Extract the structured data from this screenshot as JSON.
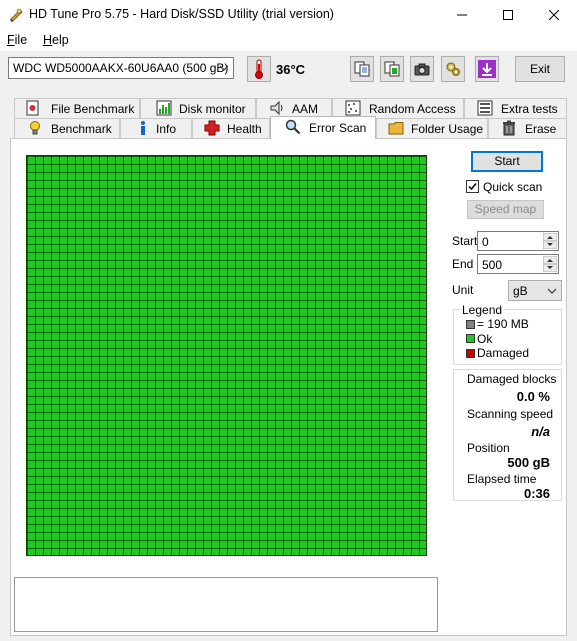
{
  "window": {
    "title": "HD Tune Pro 5.75 - Hard Disk/SSD Utility (trial version)",
    "controls": {
      "minimize": "–",
      "maximize": "☐",
      "close": "✕"
    }
  },
  "menu": {
    "file": "File",
    "file_hotkey": "F",
    "file_rest": "ile",
    "help": "Help",
    "help_hotkey": "H",
    "help_rest": "elp"
  },
  "toolbar": {
    "drive": "WDC WD5000AAKX-60U6AA0 (500 gB)",
    "temperature": "36°C",
    "exit_label": "Exit",
    "icons": [
      "copy-text-icon",
      "copy-screenshot-icon",
      "camera-icon",
      "options-icon",
      "save-icon"
    ]
  },
  "tabs": {
    "top_row": [
      "File Benchmark",
      "Disk monitor",
      "AAM",
      "Random Access",
      "Extra tests"
    ],
    "bottom_row": [
      "Benchmark",
      "Info",
      "Health",
      "Error Scan",
      "Folder Usage",
      "Erase"
    ],
    "active": "Error Scan"
  },
  "controls": {
    "start_label": "Start",
    "quick_scan_label": "Quick scan",
    "quick_scan_checked": true,
    "speed_map_label": "Speed map",
    "start_field_label": "Start",
    "start_value": "0",
    "end_field_label": "End",
    "end_value": "500",
    "unit_label": "Unit",
    "unit_value": "gB"
  },
  "legend": {
    "title": "Legend",
    "items": [
      {
        "label": "= 190 MB",
        "color": "#808080"
      },
      {
        "label": "Ok",
        "color": "#22c722"
      },
      {
        "label": "Damaged",
        "color": "#c80000"
      }
    ]
  },
  "stats": {
    "damaged_blocks_label": "Damaged blocks",
    "damaged_blocks_value": "0.0 %",
    "scanning_speed_label": "Scanning speed",
    "scanning_speed_value": "n/a",
    "position_label": "Position",
    "position_value": "500 gB",
    "elapsed_time_label": "Elapsed time",
    "elapsed_time_value": "0:36"
  },
  "scan_grid": {
    "status": "Ok",
    "ok_color": "#22c722",
    "damaged_color": "#c80000",
    "progress": 1.0
  },
  "colors": {
    "titlebar": "#ffffff",
    "window": "#f0f0f0",
    "accent": "#0078d7"
  }
}
